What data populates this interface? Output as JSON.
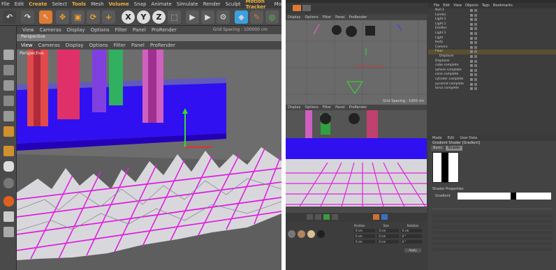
{
  "left_panel": {
    "menu": [
      "File",
      "Edit",
      "Create",
      "Select",
      "Tools",
      "Mesh",
      "Volume",
      "Snap",
      "Animate",
      "Simulate",
      "Render",
      "Sculpt",
      "Motion Tracker",
      "Mo"
    ],
    "menu_highlight": [
      "Create",
      "Tools",
      "Volume",
      "Motion Tracker"
    ],
    "viewport_bar_1": [
      "View",
      "Cameras",
      "Display",
      "Options",
      "Filter",
      "Panel",
      "ProRender"
    ],
    "viewport_label_1": "Perspective",
    "grid_spacing_text": "Grid Spacing : 100000 cm",
    "viewport_bar_2": [
      "View",
      "Cameras",
      "Display",
      "Options",
      "Filter",
      "Panel",
      "ProRender"
    ],
    "viewport_label_2": "Perspective",
    "axis_buttons": [
      "X",
      "Y",
      "Z"
    ]
  },
  "right_panel": {
    "view_top_menu": [
      "Display",
      "Options",
      "Filter",
      "Panel",
      "ProRender"
    ],
    "view_top_grid_spacing": "Grid Spacing : 1000 cm",
    "view_bottom_menu": [
      "Display",
      "Options",
      "Filter",
      "Panel",
      "ProRender"
    ],
    "object_manager_menu": [
      "File",
      "Edit",
      "View",
      "Objects",
      "Tags",
      "Bookmarks"
    ],
    "objects": [
      "Null.1",
      "Landsc",
      "Light.1",
      "Light.1",
      "Emitter",
      "Light.1",
      "Light",
      "body",
      "Camera",
      "Floor",
      "Displacer",
      "Displacer",
      "cube complete",
      "sphere complete",
      "cone complete",
      "cylinder complete",
      "pyramid complete",
      "torus complete"
    ],
    "attributes_tabs": [
      "Mode",
      "Edit",
      "User Data"
    ],
    "attributes_header": "Gradient Shader [Gradient]",
    "attributes_subtabs": [
      "Basic",
      "Shader"
    ],
    "shader_properties_label": "Shader Properties",
    "gradient_label": "Gradient",
    "material_section_labels": [
      "Position",
      "Size",
      "Rotation"
    ],
    "material_row_values": [
      "0 cm",
      "0 cm",
      "0 cm",
      "0 cm",
      "0 cm",
      "0 °",
      "0 cm",
      "0 cm",
      "0 °"
    ],
    "apply_button": "Apply"
  },
  "colors": {
    "accent_orange": "#f0b040",
    "panel_dark": "#3d3d3d",
    "viewport_gray": "#6a6a6a",
    "mesh_magenta": "#e020e0",
    "water_blue": "#3010f0"
  }
}
